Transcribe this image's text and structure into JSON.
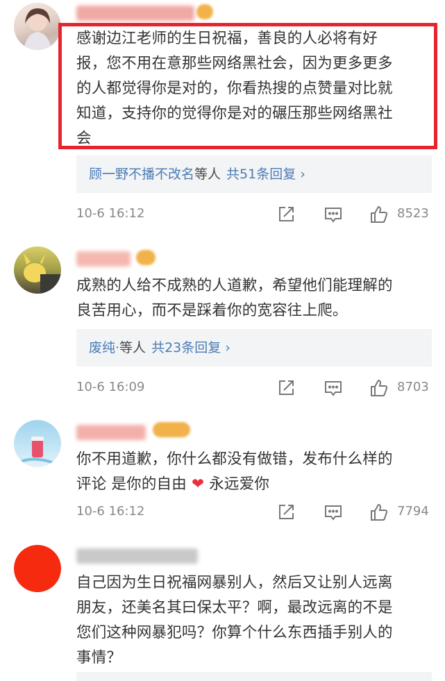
{
  "comments": [
    {
      "text_lines": [
        "感谢边江老师的生日祝福，善良的人必将有好",
        "报，您不用在意那些网络黑社会，因为更多更多",
        "的人都觉得你是对的，你看热搜的点赞量对比就",
        "知道，支持你的觉得你是对的碾压那些网络黑社",
        "会"
      ],
      "reply_name": "顾一野不播不改名",
      "reply_suffix": "等人",
      "reply_count": "共51条回复 ›",
      "time": "10-6 16:12",
      "likes": "8523"
    },
    {
      "text_lines": [
        "成熟的人给不成熟的人道歉，希望他们能理解的",
        "良苦用心，而不是踩着你的宽容往上爬。"
      ],
      "reply_name": "废纯·",
      "reply_suffix": "等人",
      "reply_count": "共23条回复 ›",
      "time": "10-6 16:09",
      "likes": "8703"
    },
    {
      "text_lines": [
        "你不用道歉，你什么都没有做错，发布什么样的",
        "评论 是你的自由 ❤ 永远爱你"
      ],
      "time": "10-6 16:12",
      "likes": "7794"
    },
    {
      "text_lines": [
        "自己因为生日祝福网暴别人，然后又让别人远离",
        "朋友，还美名其曰保太平？啊，最改远离的不是",
        "您们这种网暴犯吗？你算个什么东西插手别人的",
        "事情？"
      ]
    }
  ],
  "colors": {
    "highlight_border": "#e7232d",
    "link_blue": "#4a7bb6",
    "reply_bg": "#f3f4f5",
    "heart": "#e8303f"
  },
  "icons": {
    "share": "share-icon",
    "comment": "comment-icon",
    "like": "thumbs-up-icon"
  }
}
